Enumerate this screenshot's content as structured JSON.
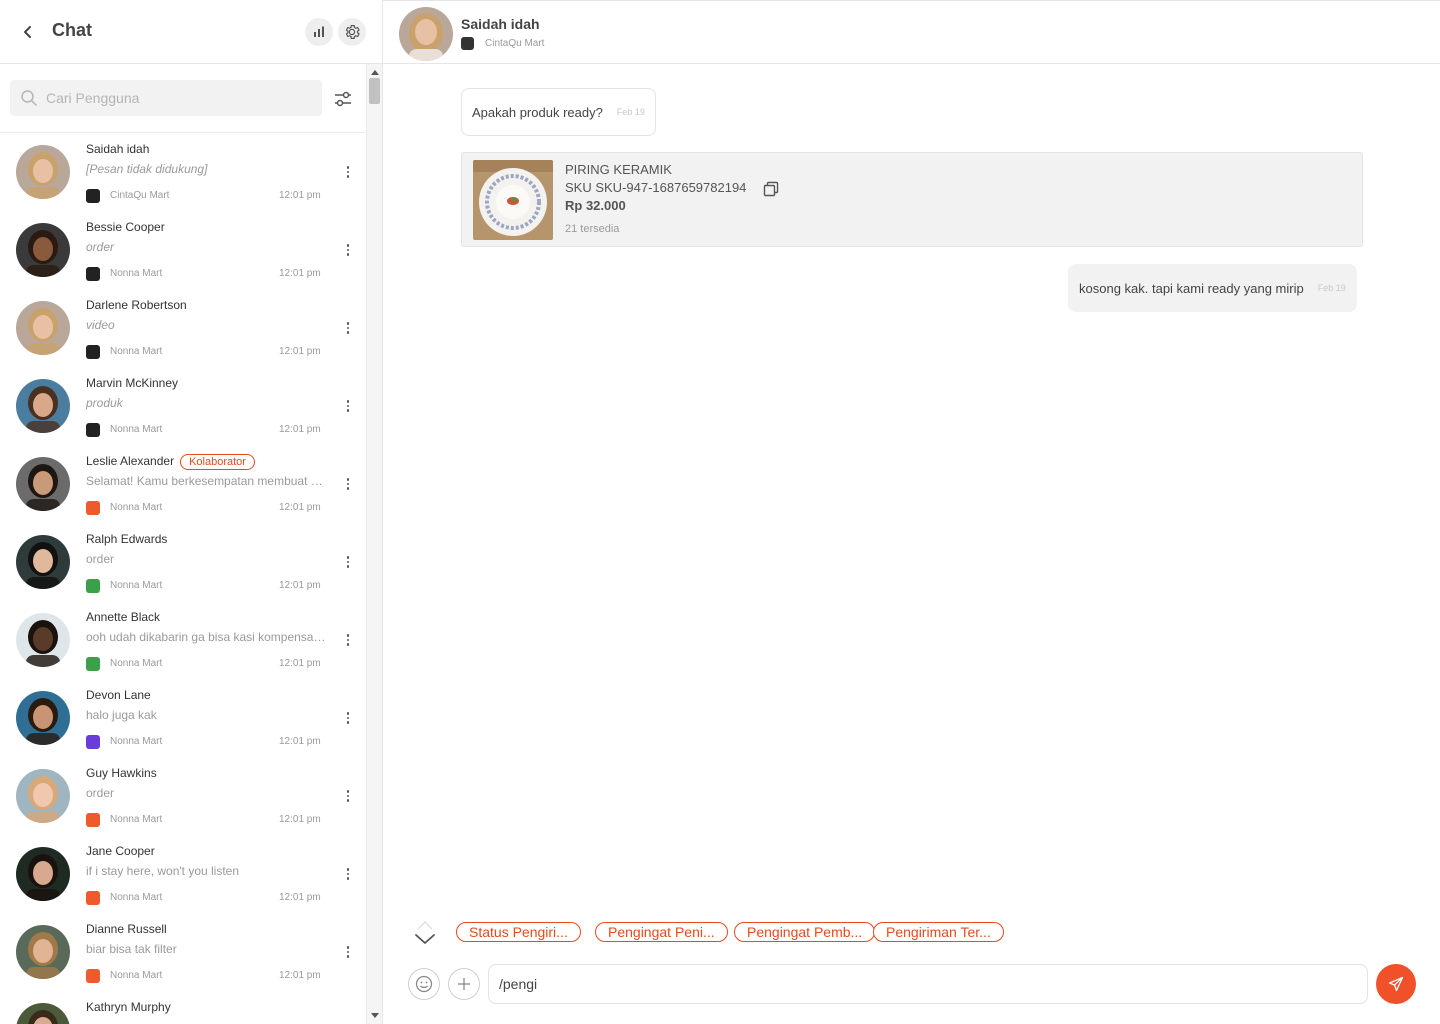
{
  "sidebar": {
    "title": "Chat",
    "icons": {
      "back": "chevron-left-icon",
      "stats": "bar-chart-icon",
      "settings": "gear-icon",
      "filter": "sliders-icon",
      "search": "search-icon"
    },
    "search_placeholder": "Cari Pengguna",
    "items": [
      {
        "name": "Saidah idah",
        "message": "[Pesan tidak didukung]",
        "italic": true,
        "shop": "CintaQu Mart",
        "time": "12:01 pm",
        "shop_color": "#222222",
        "avatar": {
          "bg": "#b9a89a",
          "skin": "#e8c1a5",
          "hair": "#c9a16c"
        }
      },
      {
        "name": "Bessie Cooper",
        "message": "order",
        "italic": true,
        "shop": "Nonna Mart",
        "time": "12:01 pm",
        "shop_color": "#222222",
        "avatar": {
          "bg": "#3a3a3a",
          "skin": "#8a5a3c",
          "hair": "#2a1a12"
        }
      },
      {
        "name": "Darlene Robertson",
        "message": "video",
        "italic": true,
        "shop": "Nonna Mart",
        "time": "12:01 pm",
        "shop_color": "#222222",
        "avatar": {
          "bg": "#b9a89a",
          "skin": "#e8c1a5",
          "hair": "#c9a16c"
        }
      },
      {
        "name": "Marvin McKinney",
        "message": "produk",
        "italic": true,
        "shop": "Nonna Mart",
        "time": "12:01 pm",
        "shop_color": "#222222",
        "avatar": {
          "bg": "#4a7da0",
          "skin": "#d9a888",
          "hair": "#4a3020"
        }
      },
      {
        "name": "Leslie Alexander",
        "badge": "Kolaborator",
        "message": "Selamat! Kamu berkesempatan membuat Sho...",
        "italic": false,
        "shop": "Nonna Mart",
        "time": "12:01 pm",
        "shop_color": "#ee5a2c",
        "avatar": {
          "bg": "#6b6b6b",
          "skin": "#c89a7a",
          "hair": "#1e1612"
        }
      },
      {
        "name": "Ralph Edwards",
        "message": "order",
        "italic": false,
        "shop": "Nonna Mart",
        "time": "12:01 pm",
        "shop_color": "#3aa04a",
        "avatar": {
          "bg": "#2f3a3a",
          "skin": "#e0b89c",
          "hair": "#111111"
        }
      },
      {
        "name": "Annette Black",
        "message": "ooh udah dikabarin ga bisa kasi kompensasi...",
        "italic": false,
        "shop": "Nonna Mart",
        "time": "12:01 pm",
        "shop_color": "#3aa04a",
        "avatar": {
          "bg": "#dfe6ea",
          "skin": "#5a3a28",
          "hair": "#1a120c"
        }
      },
      {
        "name": "Devon Lane",
        "message": "halo juga kak",
        "italic": false,
        "shop": "Nonna Mart",
        "time": "12:01 pm",
        "shop_color": "#6a3cdc",
        "avatar": {
          "bg": "#2f6f96",
          "skin": "#c89474",
          "hair": "#2a1a10"
        }
      },
      {
        "name": "Guy Hawkins",
        "message": "order",
        "italic": false,
        "shop": "Nonna Mart",
        "time": "12:01 pm",
        "shop_color": "#ee5a2c",
        "avatar": {
          "bg": "#9fb6c2",
          "skin": "#f0c8b0",
          "hair": "#d8a878"
        }
      },
      {
        "name": "Jane Cooper",
        "message": "if i stay here, won't you listen",
        "italic": false,
        "shop": "Nonna Mart",
        "time": "12:01 pm",
        "shop_color": "#ee5a2c",
        "avatar": {
          "bg": "#1e2a22",
          "skin": "#d8a890",
          "hair": "#1a120e"
        }
      },
      {
        "name": "Dianne Russell",
        "message": "biar bisa tak filter",
        "italic": false,
        "shop": "Nonna Mart",
        "time": "12:01 pm",
        "shop_color": "#ee5a2c",
        "avatar": {
          "bg": "#5a6a5a",
          "skin": "#e0b494",
          "hair": "#a07a48"
        }
      },
      {
        "name": "Kathryn Murphy",
        "message": "",
        "italic": false,
        "shop": "",
        "time": "",
        "shop_color": "#ee5a2c",
        "avatar": {
          "bg": "#4a5a3a",
          "skin": "#d8ac90",
          "hair": "#3a2a1a"
        }
      }
    ]
  },
  "conversation": {
    "contact_name": "Saidah idah",
    "contact_shop": "CintaQu Mart",
    "messages": [
      {
        "text": "Apakah produk ready?",
        "time": "Feb 19"
      },
      {
        "text": "kosong kak. tapi kami ready yang mirip",
        "time": "Feb 19"
      }
    ],
    "product": {
      "name": "PIRING KERAMIK",
      "sku": "SKU SKU-947-1687659782194",
      "price": "Rp 32.000",
      "stock": "21 tersedia"
    },
    "quick_replies": [
      "Status Pengiri...",
      "Pengingat Peni...",
      "Pengingat Pemb...",
      "Pengiriman Ter..."
    ],
    "input_value": "/pengi",
    "accent_color": "#f0502a"
  }
}
